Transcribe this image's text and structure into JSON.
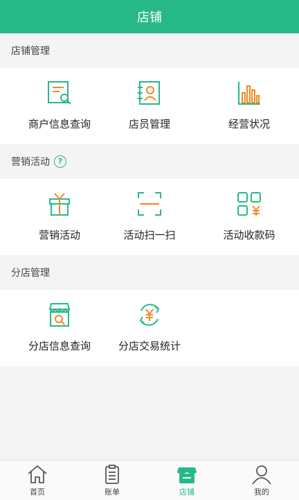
{
  "header": {
    "title": "店铺"
  },
  "sections": [
    {
      "title": "店铺管理",
      "items": [
        {
          "label": "商户信息查询",
          "icon": "merchant-search-icon"
        },
        {
          "label": "店员管理",
          "icon": "staff-card-icon"
        },
        {
          "label": "经营状况",
          "icon": "bar-chart-icon"
        }
      ]
    },
    {
      "title": "营销活动",
      "help_icon": "question-icon",
      "help_symbol": "?",
      "items": [
        {
          "label": "营销活动",
          "icon": "gift-icon"
        },
        {
          "label": "活动扫一扫",
          "icon": "scan-icon"
        },
        {
          "label": "活动收款码",
          "icon": "payment-qr-icon"
        }
      ]
    },
    {
      "title": "分店管理",
      "items": [
        {
          "label": "分店信息查询",
          "icon": "store-search-icon"
        },
        {
          "label": "分店交易统计",
          "icon": "yuan-cycle-icon"
        }
      ]
    }
  ],
  "tabbar": {
    "tabs": [
      {
        "label": "首页",
        "icon": "home-icon",
        "active": false
      },
      {
        "label": "账单",
        "icon": "clipboard-icon",
        "active": false
      },
      {
        "label": "店铺",
        "icon": "store-icon",
        "active": true
      },
      {
        "label": "我的",
        "icon": "user-icon",
        "active": false
      }
    ]
  },
  "colors": {
    "accent": "#26b987",
    "icon_orange": "#f08a24",
    "background": "#f4f4f4"
  }
}
